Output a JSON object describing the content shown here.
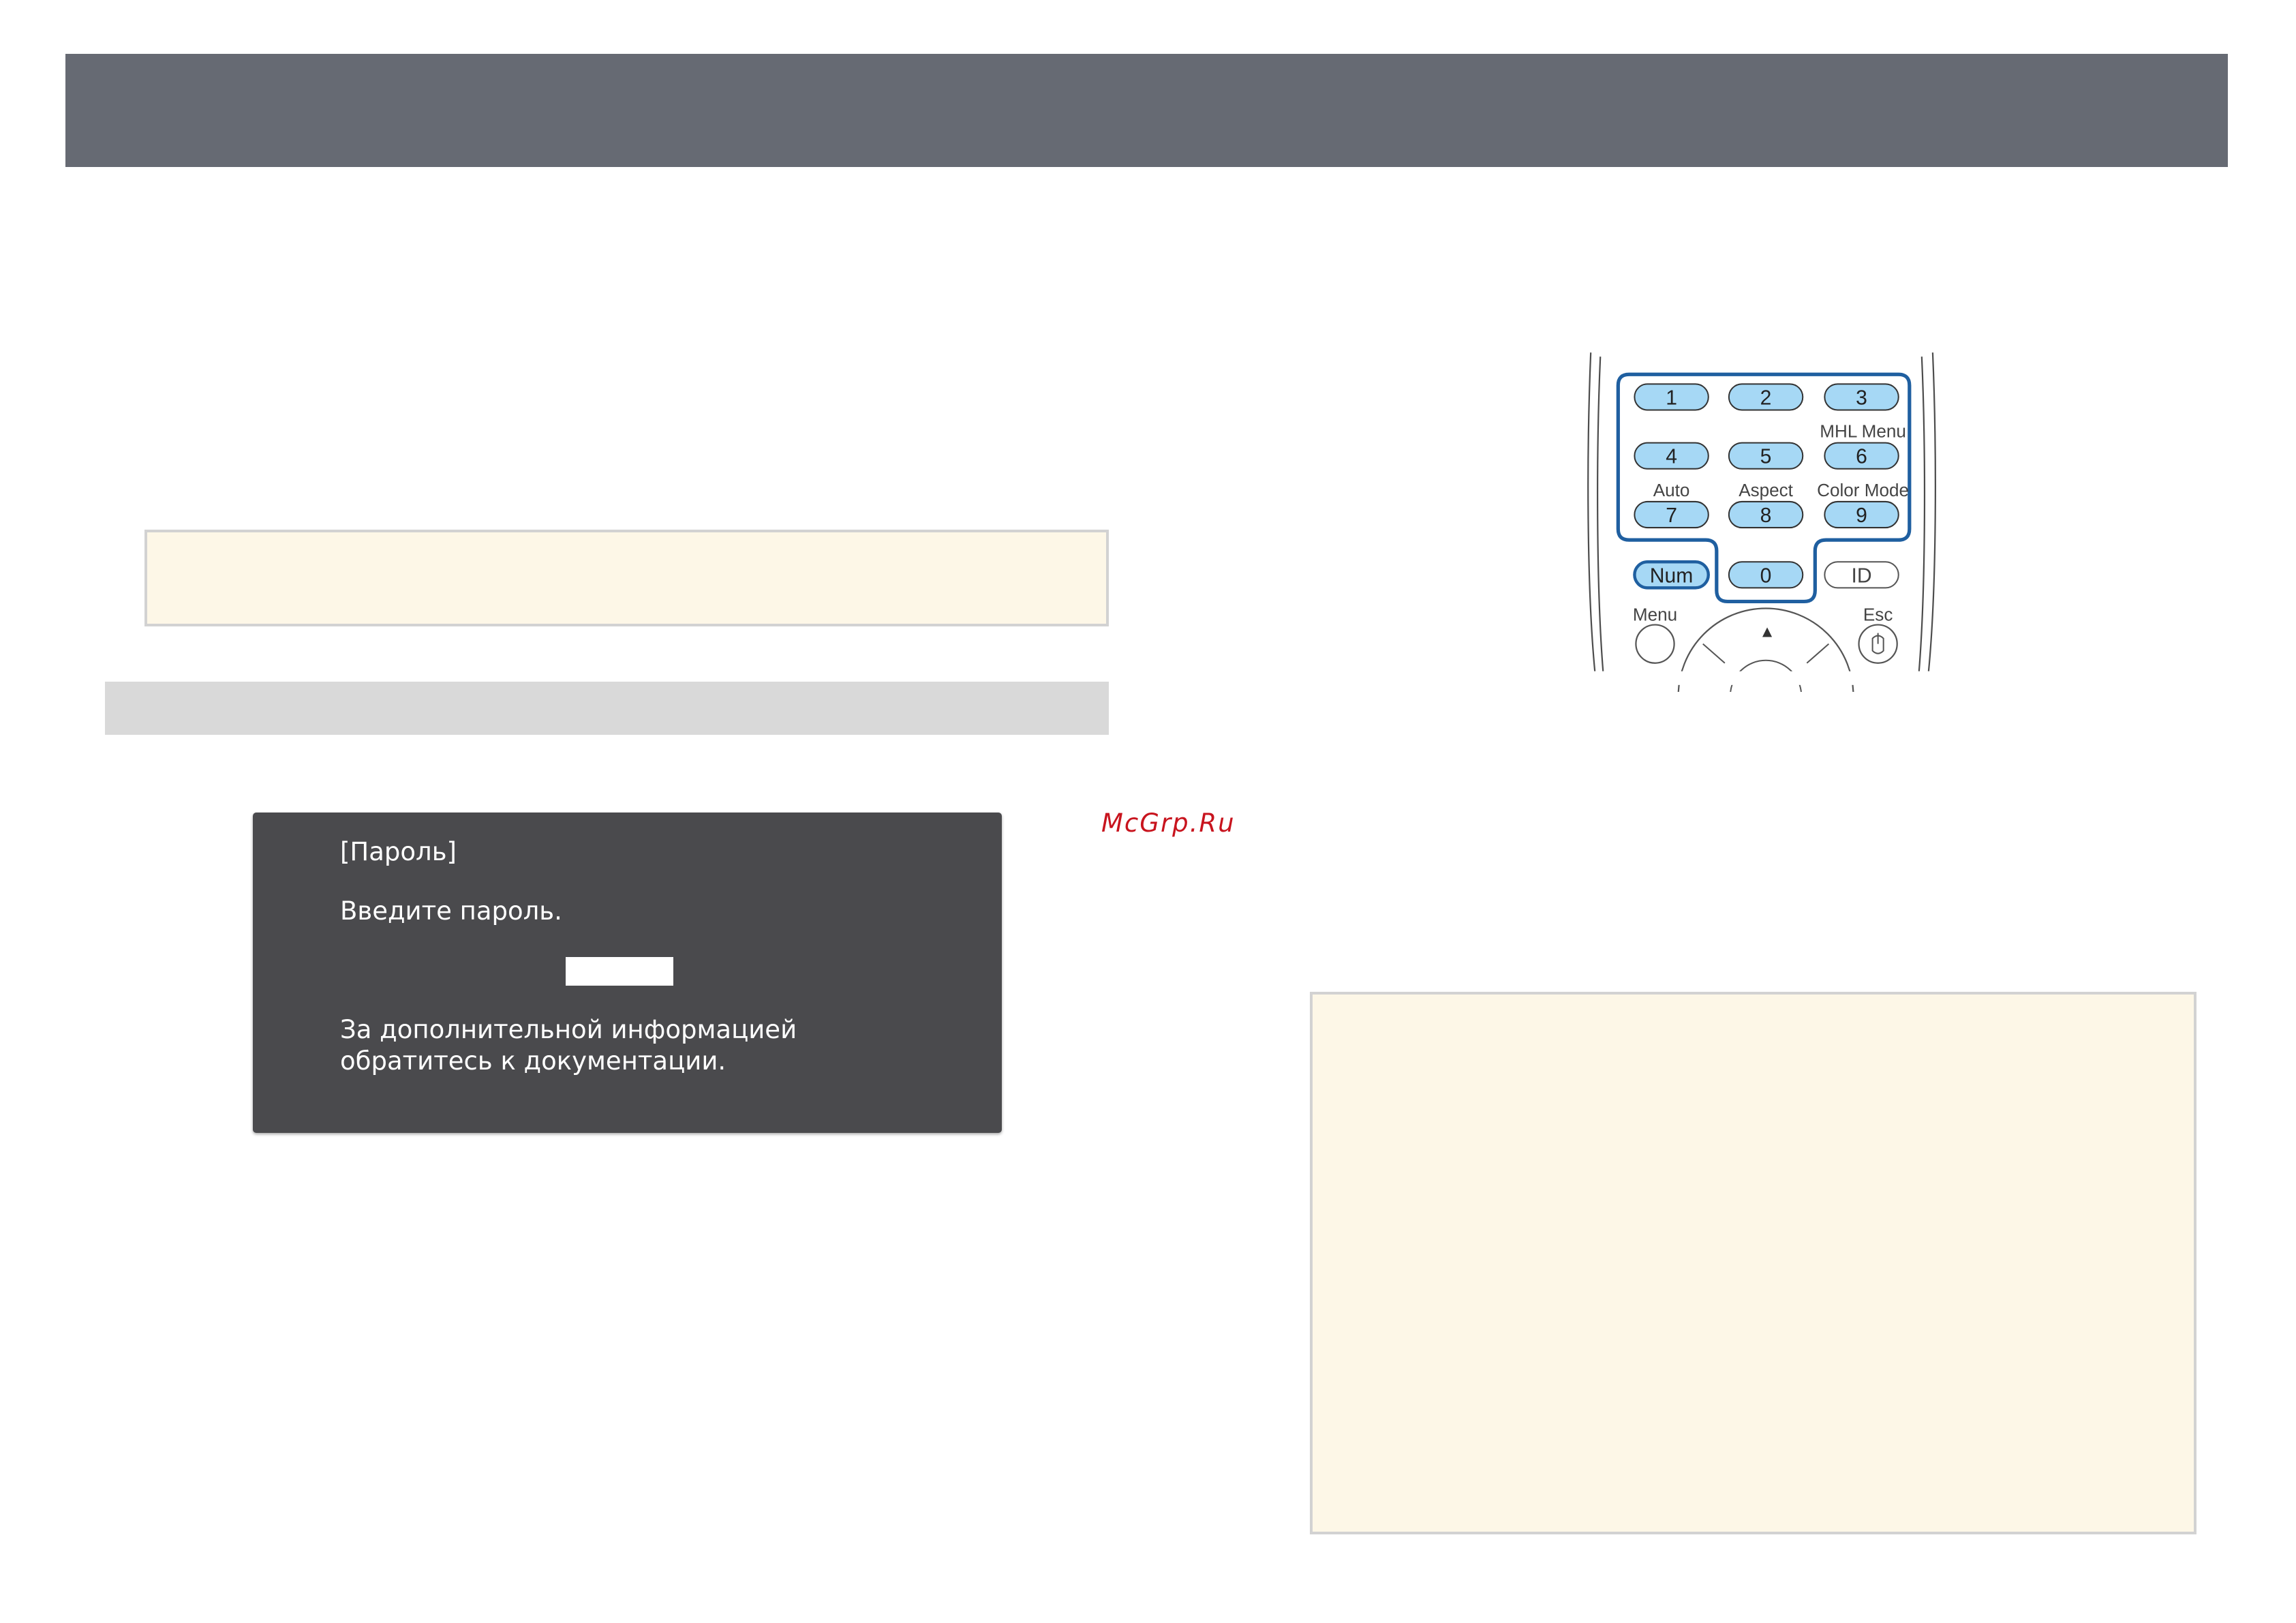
{
  "dialog": {
    "title": "[Пароль]",
    "prompt": "Введите пароль.",
    "info_line_1": "За дополнительной информацией",
    "info_line_2": "обратитесь к документации."
  },
  "remote": {
    "keys": {
      "k1": "1",
      "k2": "2",
      "k3": "3",
      "k4": "4",
      "k5": "5",
      "k6": "6",
      "k7": "7",
      "k8": "8",
      "k9": "9",
      "k0": "0",
      "num": "Num",
      "id": "ID"
    },
    "labels": {
      "mhl_menu": "MHL Menu",
      "auto": "Auto",
      "aspect": "Aspect",
      "color_mode": "Color Mode",
      "menu": "Menu",
      "esc": "Esc"
    },
    "up_arrow": "▲"
  },
  "watermark": "McGrp.Ru",
  "colors": {
    "header": "#666a73",
    "note_background": "#fdf7e7",
    "dialog_background": "#4a4a4d",
    "key_fill": "#a6d8f5",
    "highlight_outline": "#1f5fa0"
  }
}
